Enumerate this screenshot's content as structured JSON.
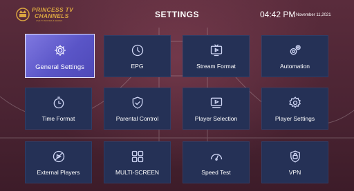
{
  "header": {
    "logo_line1": "PRINCESS TV",
    "logo_line2": "CHANNELS",
    "logo_line3": "LIVE TV MOVIES & SERIES",
    "title": "SETTINGS",
    "time": "04:42 PM",
    "date": "November 11,2021"
  },
  "tiles": [
    {
      "label": "General Settings",
      "icon": "gears-icon",
      "active": true
    },
    {
      "label": "EPG",
      "icon": "clock-icon"
    },
    {
      "label": "Stream Format",
      "icon": "tv-play-icon"
    },
    {
      "label": "Automation",
      "icon": "automation-gears-icon"
    },
    {
      "label": "Time Format",
      "icon": "timer-icon"
    },
    {
      "label": "Parental Control",
      "icon": "shield-check-icon"
    },
    {
      "label": "Player Selection",
      "icon": "player-screen-icon"
    },
    {
      "label": "Player Settings",
      "icon": "gear-icon"
    },
    {
      "label": "External Players",
      "icon": "external-player-icon"
    },
    {
      "label": "MULTI-SCREEN",
      "icon": "grid-icon"
    },
    {
      "label": "Speed Test",
      "icon": "speedometer-icon"
    },
    {
      "label": "VPN",
      "icon": "vpn-shield-icon"
    }
  ],
  "colors": {
    "tile": "#253156",
    "active_tile": "#6a64d4",
    "logo_gold": "#d9a441"
  }
}
